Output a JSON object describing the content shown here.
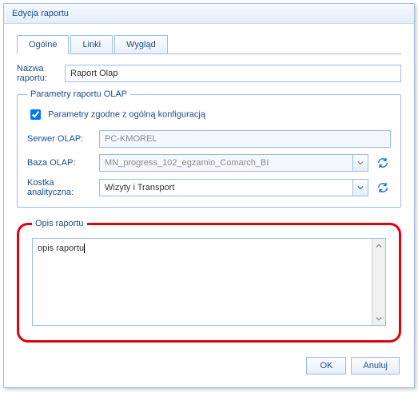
{
  "window": {
    "title": "Edycja raportu"
  },
  "tabs": [
    {
      "label": "Ogólne",
      "active": true
    },
    {
      "label": "Linki",
      "active": false
    },
    {
      "label": "Wygląd",
      "active": false
    }
  ],
  "report_name": {
    "label": "Nazwa raportu:",
    "value": "Raport Olap"
  },
  "olap": {
    "legend": "Parametry raportu OLAP",
    "config_checkbox": {
      "label": "Parametry zgodne z ogólną konfiguracją",
      "checked": true
    },
    "server": {
      "label": "Serwer OLAP:",
      "value": "PC-KMOREL",
      "enabled": false
    },
    "database": {
      "label": "Baza OLAP:",
      "value": "MN_progress_102_egzamin_Comarch_BI",
      "enabled": false
    },
    "cube": {
      "label": "Kostka analityczna:",
      "value": "Wizyty i Transport",
      "enabled": true
    }
  },
  "description": {
    "legend": "Opis raportu",
    "value": "opis raportu"
  },
  "buttons": {
    "ok": "OK",
    "cancel": "Anuluj"
  }
}
